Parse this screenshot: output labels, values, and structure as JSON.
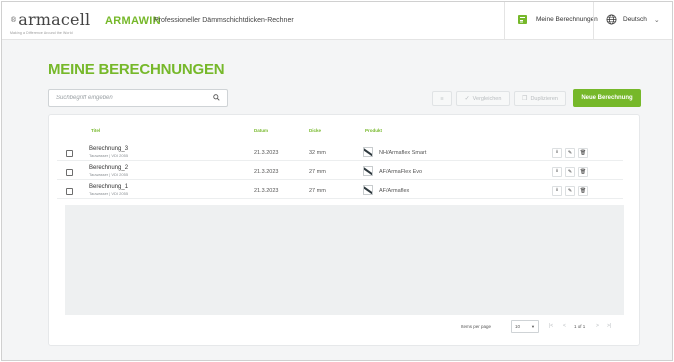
{
  "header": {
    "logo_text": "armacell",
    "logo_tagline": "Making a Difference Around the World",
    "brand": "ARMAWIN",
    "app_title": "Professioneller Dämmschichtdicken-Rechner",
    "my_calculations_label": "Meine Berechnungen",
    "language_label": "Deutsch"
  },
  "page_title": "MEINE BERECHNUNGEN",
  "toolbar": {
    "search_placeholder": "Suchbegriff eingeben",
    "compare_label": "Vergleichen",
    "duplicate_label": "Duplizieren",
    "new_label": "Neue Berechnung"
  },
  "table": {
    "columns": {
      "title": "Titel",
      "date": "Datum",
      "thickness": "Dicke",
      "product": "Produkt"
    },
    "rows": [
      {
        "title": "Berechnung_3",
        "subtitle": "Tauwasser | VDI 2055",
        "date": "21.3.2023",
        "thickness": "32 mm",
        "product": "NH/Armaflex Smart"
      },
      {
        "title": "Berechnung_2",
        "subtitle": "Tauwasser | VDI 2055",
        "date": "21.3.2023",
        "thickness": "27 mm",
        "product": "AF/ArmaFlex Evo"
      },
      {
        "title": "Berechnung_1",
        "subtitle": "Tauwasser | VDI 2055",
        "date": "21.3.2023",
        "thickness": "27 mm",
        "product": "AF/Armaflex"
      }
    ]
  },
  "pagination": {
    "items_per_page_label": "Items per page",
    "items_per_page": "10",
    "page_info": "1 of 1"
  },
  "colors": {
    "accent": "#76b82a"
  },
  "icons": {
    "my_calculations": "calculator-icon",
    "language": "globe-icon",
    "search": "search-icon",
    "filter": "filter-icon",
    "compare": "check-icon",
    "duplicate": "copy-icon",
    "download": "download-icon",
    "edit": "pencil-icon",
    "delete": "trash-icon"
  }
}
